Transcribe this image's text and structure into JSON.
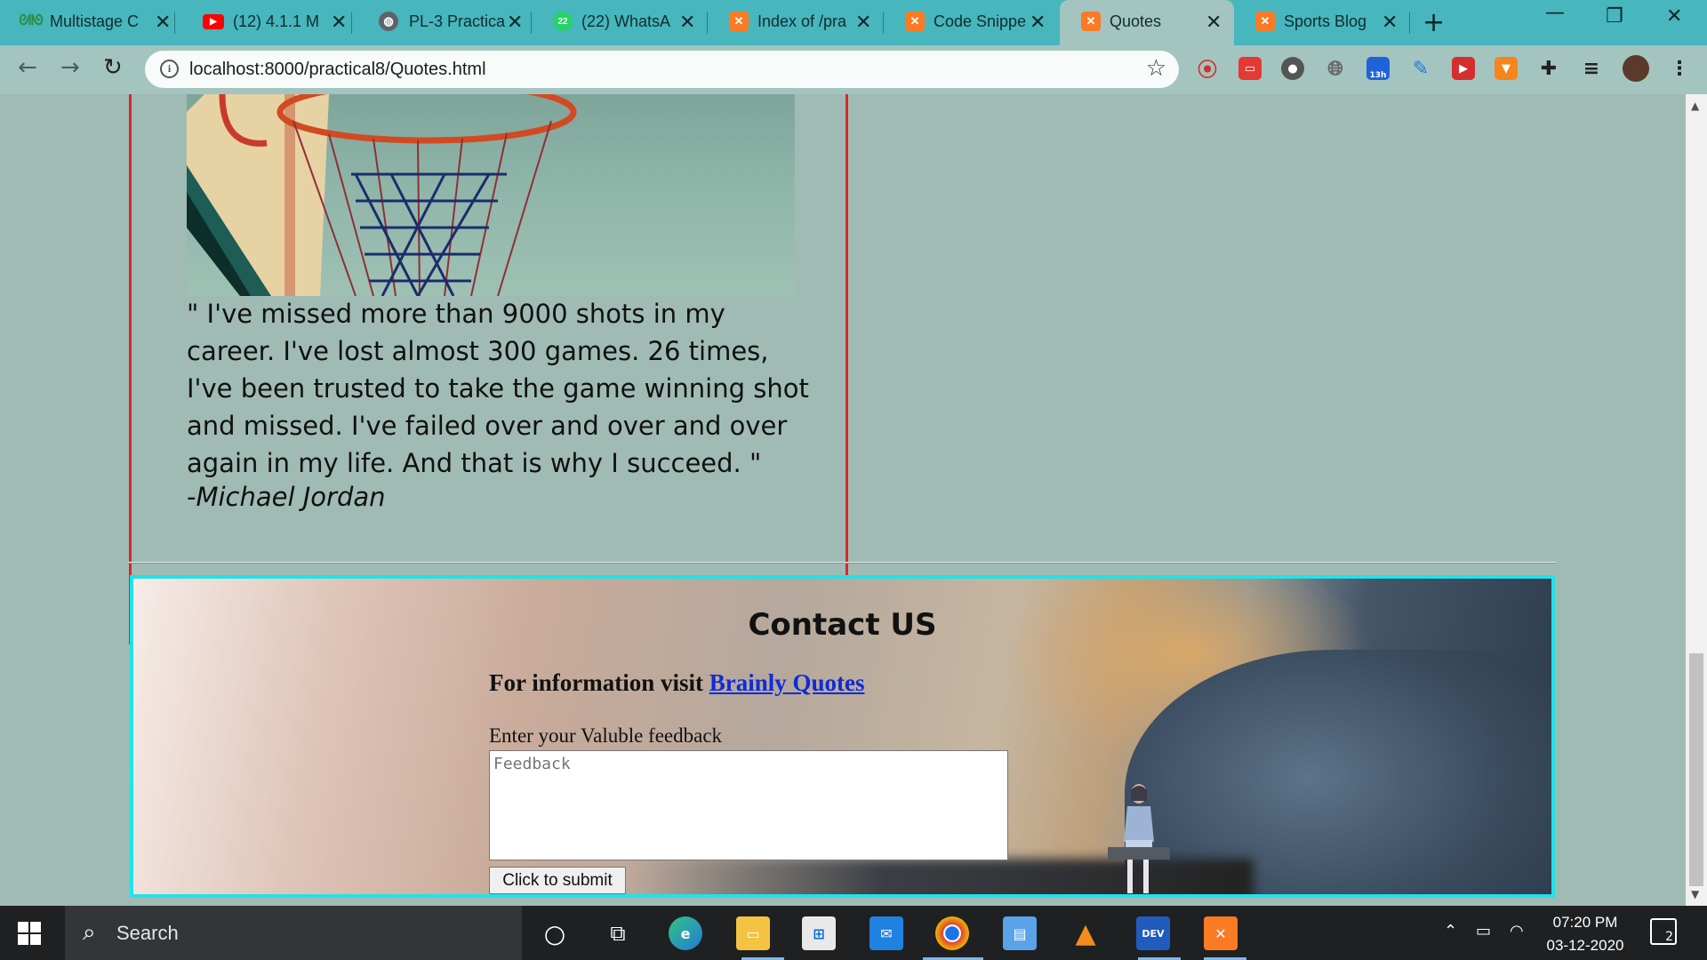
{
  "browser": {
    "tabs": [
      {
        "label": "Multistage C",
        "icon": "geeksforgeeks-icon",
        "color": "#2f8d46"
      },
      {
        "label": "(12) 4.1.1 M",
        "icon": "youtube-icon",
        "color": "#ff0000"
      },
      {
        "label": "PL-3 Practica",
        "icon": "globe-icon",
        "color": "#5f6368"
      },
      {
        "label": "(22) WhatsA",
        "icon": "whatsapp-icon",
        "color": "#25d366"
      },
      {
        "label": "Index of /pra",
        "icon": "xampp-icon",
        "color": "#fb7a24"
      },
      {
        "label": "Code Snippe",
        "icon": "xampp-icon",
        "color": "#fb7a24"
      },
      {
        "label": "Quotes",
        "icon": "xampp-icon",
        "color": "#fb7a24",
        "active": true
      },
      {
        "label": "Sports Blog",
        "icon": "xampp-icon",
        "color": "#fb7a24"
      }
    ],
    "new_tab_label": "+",
    "url": "localhost:8000/practical8/Quotes.html",
    "extension_badge": "13h"
  },
  "page": {
    "quote_text": "\" I've missed more than 9000 shots in my career. I've lost almost 300 games. 26 times, I've been trusted to take the game winning shot and missed. I've failed over and over and over again in my life. And that is why I succeed. \"",
    "quote_author": "-Michael Jordan",
    "contact": {
      "heading": "Contact US",
      "info_prefix": "For information visit ",
      "info_link": "Brainly Quotes",
      "feedback_label": "Enter your Valuble feedback",
      "feedback_placeholder": "Feedback",
      "submit_label": "Click to submit"
    }
  },
  "taskbar": {
    "search_placeholder": "Search",
    "time": "07:20 PM",
    "date": "03-12-2020",
    "notification_count": "2",
    "dev_label": "DEV"
  },
  "colors": {
    "page_background": "#a0bbb4",
    "quote_border": "#d8272b",
    "contact_border": "#1fe3e9",
    "link": "#0f2bd6",
    "tab_strip": "#47b6bd"
  }
}
